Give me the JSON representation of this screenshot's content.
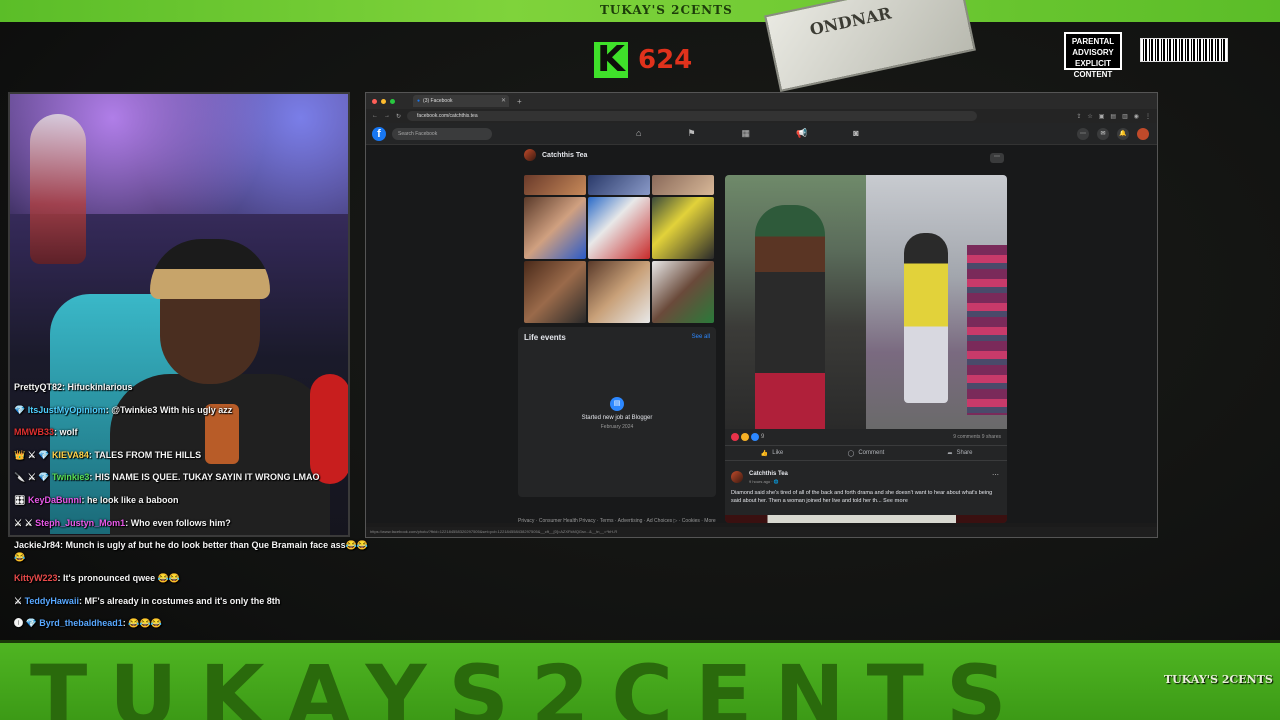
{
  "overlay": {
    "top_title": "TUKAY'S 2CENTS",
    "bill_text": "ONDNAR",
    "k_letter": "K",
    "k_count": "624",
    "advisory_text": "PARENTAL ADVISORY EXPLICIT CONTENT",
    "bottom_text": "TUKAYS2CENTS",
    "bottom_logo": "TUKAY'S 2CENTS",
    "colors": {
      "banner_green": "#5bbd28",
      "k_green": "#3fe12a",
      "k_count_red": "#e0321c"
    }
  },
  "chat": [
    {
      "user": "PrettyQT82",
      "user_color": "#f4f4f4",
      "badge": "",
      "message": "Hifuckinlarious"
    },
    {
      "user": "ItsJustMyOpiniom",
      "user_color": "#4fd0ff",
      "badge": "💎",
      "message": "@Twinkie3 With his ugly azz"
    },
    {
      "user": "MMWB33",
      "user_color": "#e03030",
      "badge": "",
      "message": "wolf"
    },
    {
      "user": "KIEVA84",
      "user_color": "#ffd24a",
      "badge": "👑 ⚔ 💎",
      "message": "TALES FROM THE HILLS"
    },
    {
      "user": "Twinkie3",
      "user_color": "#58e058",
      "badge": "🔪 ⚔ 💎",
      "message": "HIS NAME IS QUEE. TUKAY SAYIN IT WRONG LMAO"
    },
    {
      "user": "KeyDaBunni",
      "user_color": "#e858e8",
      "badge": "🎛",
      "message": "he look like a baboon"
    },
    {
      "user": "Steph_Justyn_Mom1",
      "user_color": "#e858e8",
      "badge": "⚔ ⚔",
      "message": "Who even follows him?"
    },
    {
      "user": "JackieJr84",
      "user_color": "#f4f4f4",
      "badge": "",
      "message": "Munch is ugly af but he do look better than Que Bramain face ass😂😂😂"
    },
    {
      "user": "KittyW223",
      "user_color": "#e84a4a",
      "badge": "",
      "message": "It's pronounced qwee 😂😂"
    },
    {
      "user": "TeddyHawaii",
      "user_color": "#58a8ff",
      "badge": "⚔",
      "message": "MF's already in costumes and it's only the 8th"
    },
    {
      "user": "Byrd_thebaldhead1",
      "user_color": "#58a8ff",
      "badge": "🅘 💎",
      "message": "😂😂😂"
    }
  ],
  "browser": {
    "tab_title": "(3) Facebook",
    "url": "facebook.com/catchthis.tea",
    "status_url": "https://www.facebook.com/photo/?fbid=122184558320297505&set=pcb.122184558438297505&__cft__[0]=AZXFkMQGsv...&__tn__=*bH-R"
  },
  "facebook": {
    "search_placeholder": "Search Facebook",
    "page_name": "Catchthis Tea",
    "life_events": {
      "title": "Life events",
      "see_all": "See all",
      "event_text": "Started new job at Blogger",
      "event_date": "February 2024"
    },
    "footer": "Privacy · Consumer Health Privacy · Terms · Advertising · Ad Choices ▷ · Cookies · More",
    "post": {
      "comments_shares": "9 comments  9 shares",
      "reaction_count": "9",
      "like": "Like",
      "comment": "Comment",
      "share": "Share"
    },
    "post2": {
      "name": "Catchthis Tea",
      "time": "9 hours ago · 🌐",
      "text": "Diamond said she's tired of all of the back and forth drama and she doesn't want to hear about what's being said about her. Then a woman joined her live and told her th...",
      "see_more": "See more"
    }
  }
}
